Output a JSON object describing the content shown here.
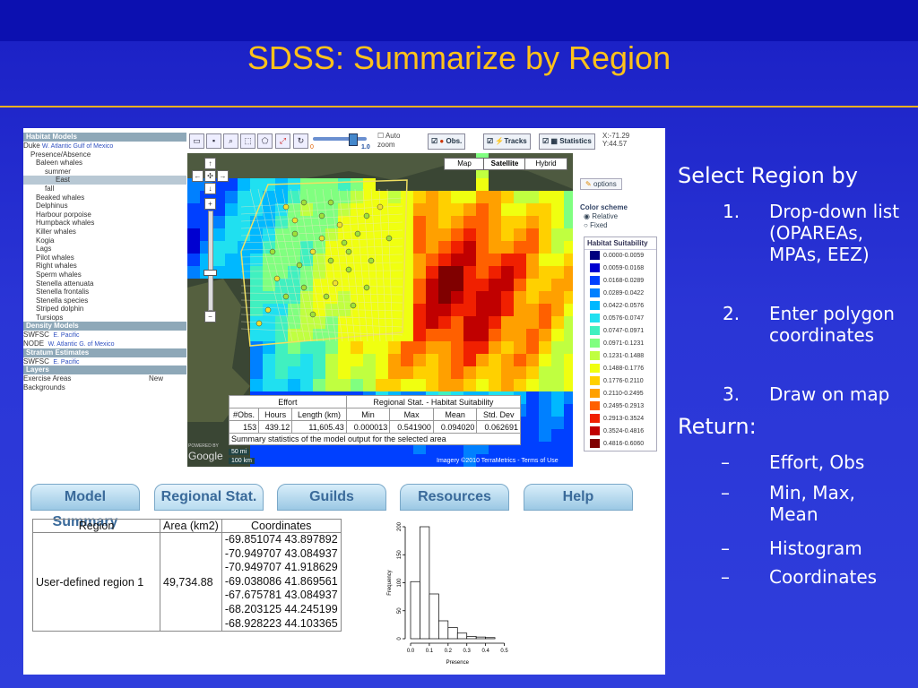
{
  "title": "SDSS: Summarize by Region",
  "tree": {
    "habitat_header": "Habitat Models",
    "duke": "Duke",
    "duke_regions": "W. Atlantic   Gulf of Mexico",
    "presence": "Presence/Absence",
    "baleen": "Baleen whales",
    "summer": "summer",
    "east": "East",
    "fall": "fall",
    "species": [
      "Beaked whales",
      "Delphinus",
      "Harbour porpoise",
      "Humpback whales",
      "Killer whales",
      "Kogia",
      "Lags",
      "Pilot whales",
      "Right whales",
      "Sperm whales",
      "Stenella attenuata",
      "Stenella frontalis",
      "Stenella species",
      "Striped dolphin",
      "Tursiops"
    ],
    "density_header": "Density Models",
    "swfsc": "SWFSC",
    "swfsc_region": "E. Pacific",
    "node": "NODE",
    "node_regions": "W. Atlantic   G. of Mexico",
    "stratum_header": "Stratum Estimates",
    "swfsc2": "SWFSC",
    "swfsc2_region": "E. Pacific",
    "layers_header": "Layers",
    "exercise": "Exercise Areas",
    "new": "New",
    "backgrounds": "Backgrounds"
  },
  "toolbar": {
    "slider_min": "0",
    "slider_max": "1.0",
    "auto": "Auto",
    "zoom": "zoom",
    "obs": "Obs.",
    "tracks": "Tracks",
    "statistics": "Statistics",
    "x": "X:-71.29",
    "y": "Y:44.57"
  },
  "map": {
    "tab_map": "Map",
    "tab_satellite": "Satellite",
    "tab_hybrid": "Hybrid",
    "scale_mi": "50 mi",
    "scale_km": "100 km",
    "powered": "POWERED BY",
    "google": "Google",
    "imagery": "Imagery ©2010 TerraMetrics - Terms of Use"
  },
  "stats": {
    "effort": "Effort",
    "regional": "Regional Stat. - Habitat Suitability",
    "headers": [
      "#Obs.",
      "Hours",
      "Length (km)",
      "Min",
      "Max",
      "Mean",
      "Std. Dev"
    ],
    "values": [
      "153",
      "439.12",
      "11,605.43",
      "0.000013",
      "0.541900",
      "0.094020",
      "0.062691"
    ],
    "caption": "Summary statistics of the model output for the selected area"
  },
  "right_panel": {
    "options": "options",
    "color_scheme": "Color scheme",
    "relative": "Relative",
    "fixed": "Fixed",
    "legend_title": "Habitat Suitability",
    "legend": [
      {
        "label": "0.0000-0.0059",
        "color": "#00007f"
      },
      {
        "label": "0.0059-0.0168",
        "color": "#0000d0"
      },
      {
        "label": "0.0168-0.0289",
        "color": "#0040ff"
      },
      {
        "label": "0.0289-0.0422",
        "color": "#0080ff"
      },
      {
        "label": "0.0422-0.0576",
        "color": "#00b8ff"
      },
      {
        "label": "0.0576-0.0747",
        "color": "#20e0f0"
      },
      {
        "label": "0.0747-0.0971",
        "color": "#40f0c0"
      },
      {
        "label": "0.0971-0.1231",
        "color": "#80ff80"
      },
      {
        "label": "0.1231-0.1488",
        "color": "#c0ff40"
      },
      {
        "label": "0.1488-0.1776",
        "color": "#f0ff10"
      },
      {
        "label": "0.1776-0.2110",
        "color": "#ffd000"
      },
      {
        "label": "0.2110-0.2495",
        "color": "#ffa000"
      },
      {
        "label": "0.2495-0.2913",
        "color": "#ff6000"
      },
      {
        "label": "0.2913-0.3524",
        "color": "#f02000"
      },
      {
        "label": "0.3524-0.4816",
        "color": "#c00000"
      },
      {
        "label": "0.4816-0.6060",
        "color": "#800000"
      }
    ]
  },
  "bottom_tabs": [
    "Model Summary",
    "Regional Stat.",
    "Guilds",
    "Resources",
    "Help"
  ],
  "region_table": {
    "headers": [
      "Region",
      "Area (km2)",
      "Coordinates"
    ],
    "region": "User-defined region 1",
    "area": "49,734.88",
    "coords": [
      "-69.851074 43.897892",
      "-70.949707 43.084937",
      "-70.949707 41.918629",
      "-69.038086 41.869561",
      "-67.675781 43.084937",
      "-68.203125 44.245199",
      "-68.928223 44.103365"
    ]
  },
  "histogram": {
    "ylabel": "Frequency",
    "xlabel": "Presence",
    "yticks": [
      "0",
      "50",
      "100",
      "150",
      "200"
    ],
    "xticks": [
      "0.0",
      "0.1",
      "0.2",
      "0.3",
      "0.4",
      "0.5"
    ],
    "bins": [
      0.0,
      0.05,
      0.1,
      0.15,
      0.2,
      0.25,
      0.3,
      0.35,
      0.4,
      0.45,
      0.5,
      0.55
    ],
    "counts": [
      102,
      200,
      80,
      32,
      20,
      10,
      4,
      3,
      2,
      0,
      0
    ]
  },
  "bullets": {
    "select": "Select Region by",
    "items": [
      {
        "n": "1.",
        "t": "Drop-down list (OPAREAs, MPAs, EEZ)"
      },
      {
        "n": "2.",
        "t": "Enter polygon coordinates"
      },
      {
        "n": "3.",
        "t": "Draw on map"
      }
    ],
    "return": "Return:",
    "dash": "–",
    "returns": [
      "Effort, Obs",
      "Min, Max, Mean",
      "Histogram",
      "Coordinates"
    ]
  }
}
